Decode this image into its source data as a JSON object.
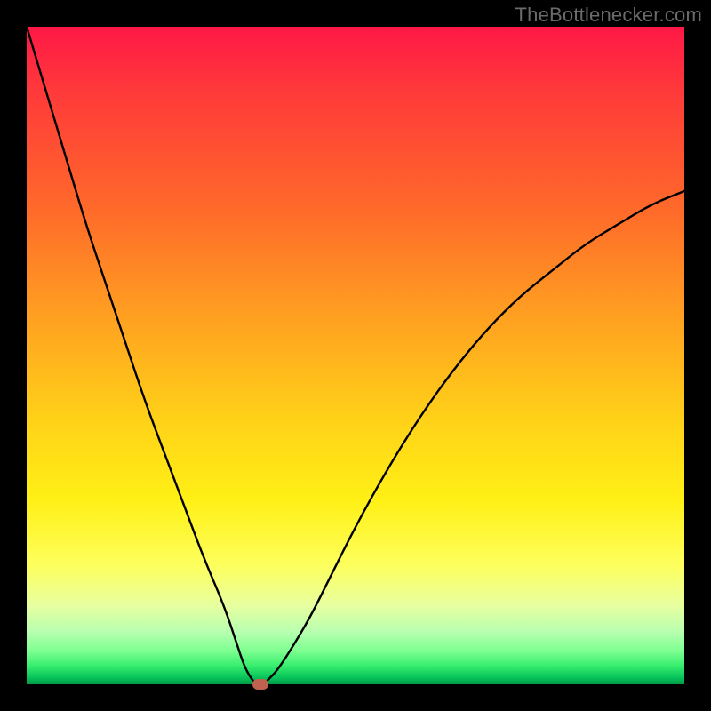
{
  "attribution": "TheBottlenecker.com",
  "colors": {
    "frame": "#000000",
    "curve": "#000000",
    "marker": "#c1614f",
    "gradient_top": "#ff1846",
    "gradient_bottom": "#009944"
  },
  "chart_data": {
    "type": "line",
    "title": "",
    "xlabel": "",
    "ylabel": "",
    "xlim": [
      0,
      100
    ],
    "ylim": [
      0,
      100
    ],
    "series": [
      {
        "name": "bottleneck-curve",
        "x": [
          0,
          3,
          6,
          9,
          12,
          15,
          18,
          21,
          24,
          27,
          30,
          32,
          33,
          34,
          35,
          36,
          37,
          38,
          40,
          43,
          46,
          50,
          55,
          60,
          65,
          70,
          75,
          80,
          85,
          90,
          95,
          100
        ],
        "values": [
          100,
          90,
          80,
          70,
          61,
          52,
          43,
          35,
          27,
          19,
          12,
          6,
          3,
          1,
          0,
          0,
          1,
          2,
          5,
          10,
          16,
          24,
          33,
          41,
          48,
          54,
          59,
          63,
          67,
          70,
          73,
          75
        ]
      }
    ],
    "annotations": [
      {
        "name": "optimum-marker",
        "x": 35.5,
        "y": 0
      }
    ]
  }
}
